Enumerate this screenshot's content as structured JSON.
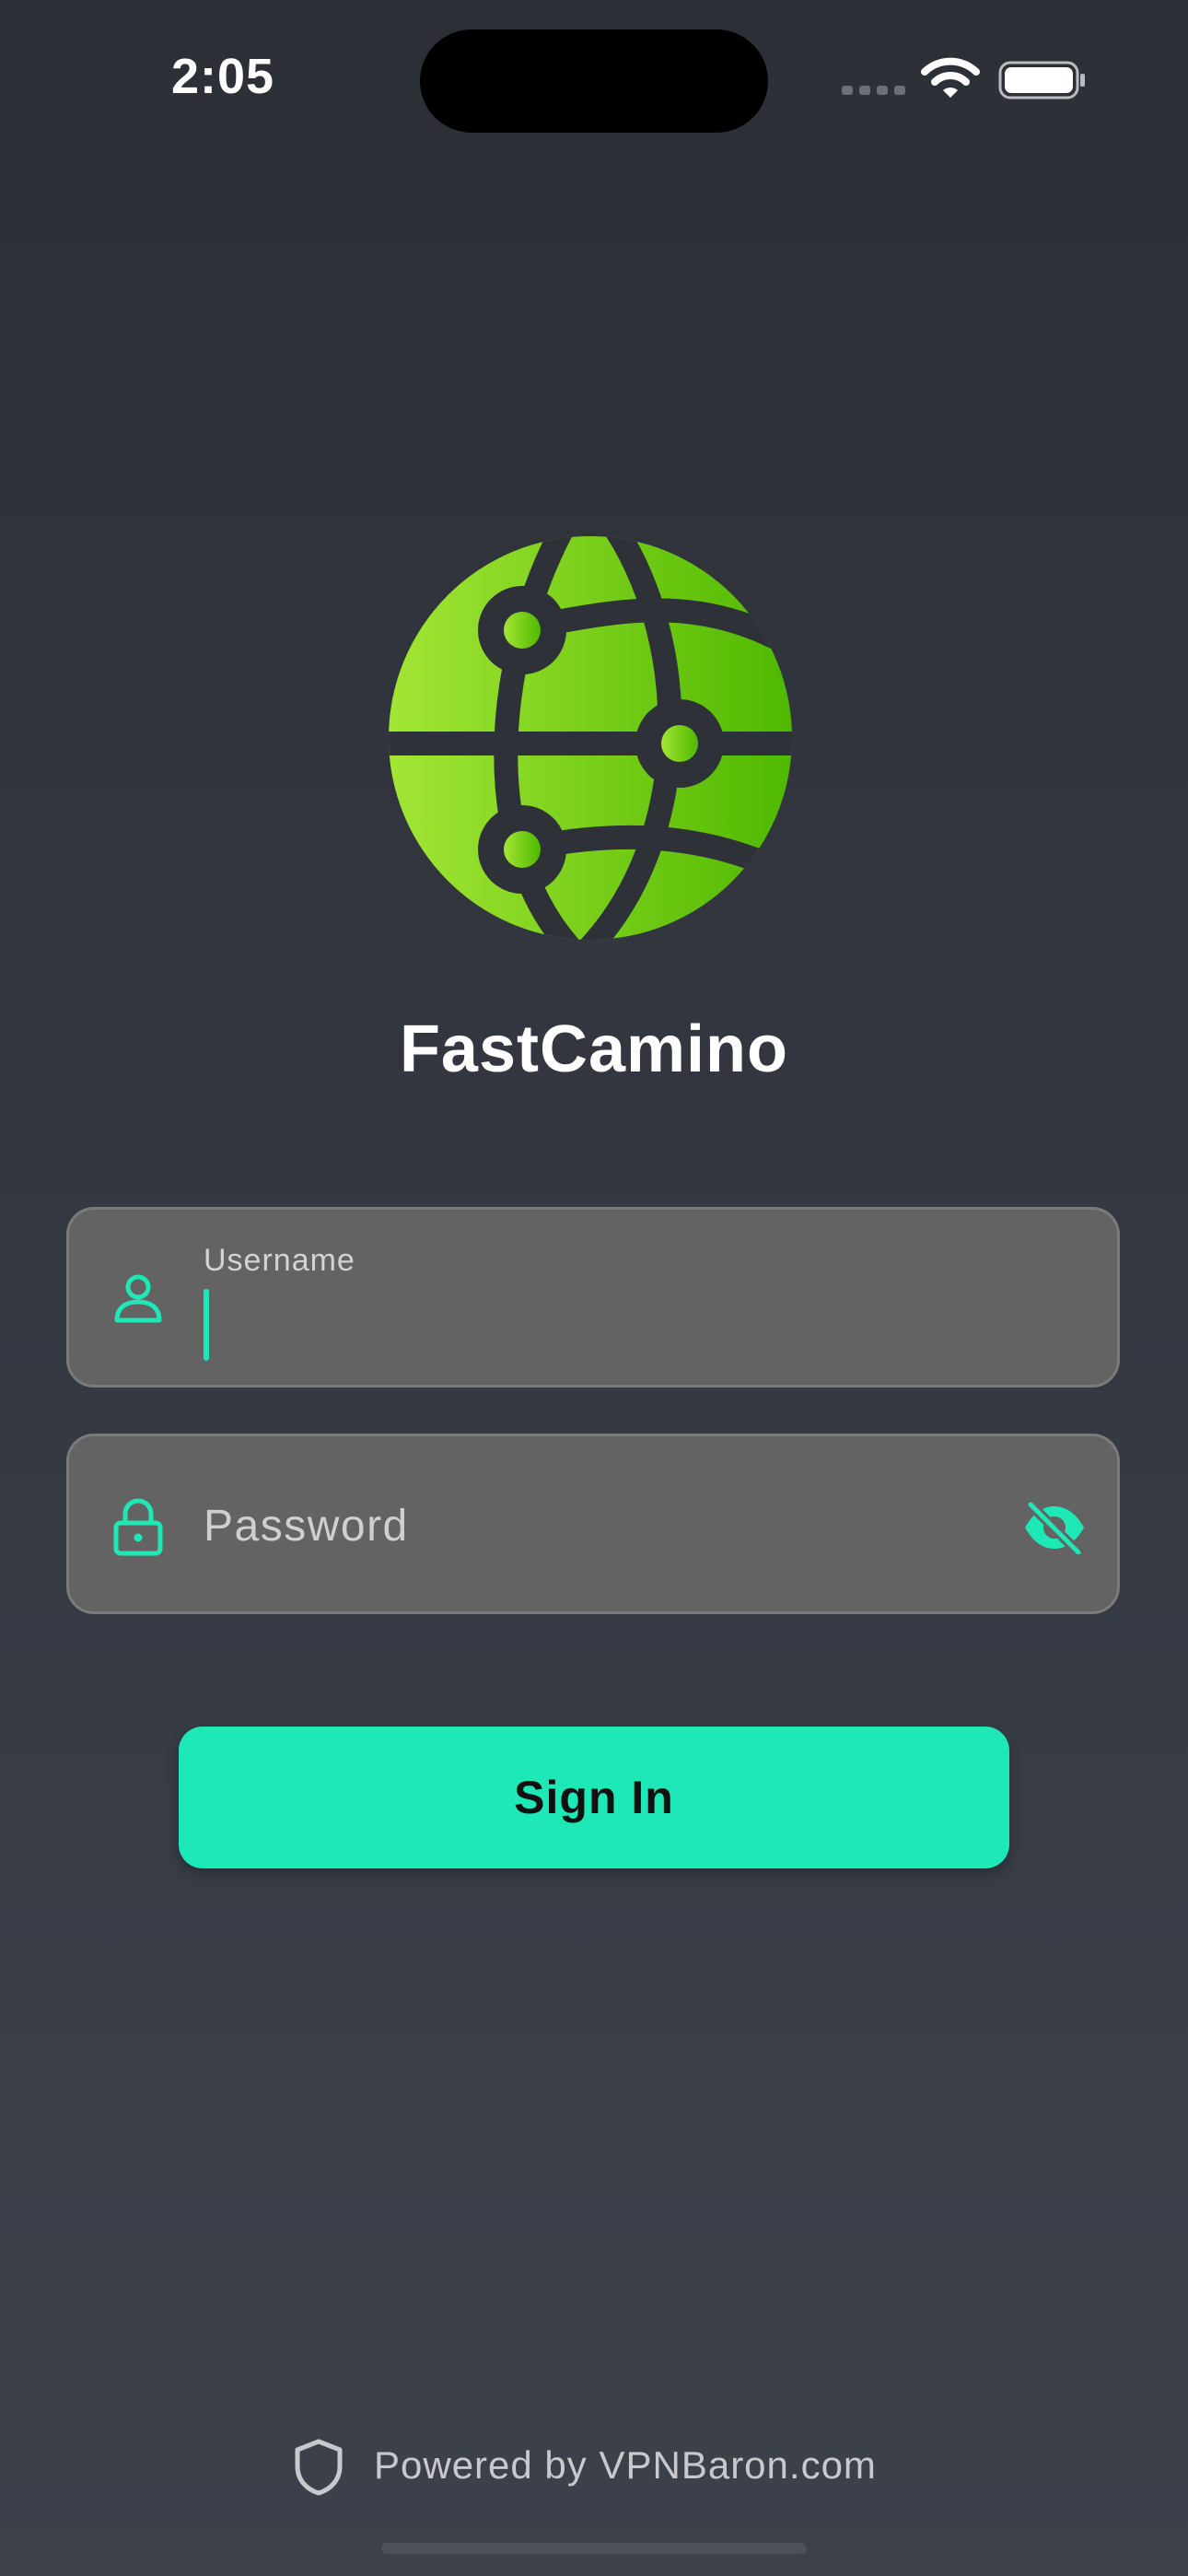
{
  "status_bar": {
    "time": "2:05"
  },
  "app": {
    "name": "FastCamino",
    "logo_icon": "globe-routes-logo-icon",
    "logo_colors": [
      "#a3e635",
      "#4fb800"
    ]
  },
  "form": {
    "username": {
      "label": "Username",
      "value": "",
      "icon": "person-icon"
    },
    "password": {
      "placeholder": "Password",
      "value": "",
      "icon": "lock-icon",
      "toggle_icon": "eye-off-icon"
    },
    "submit_label": "Sign In"
  },
  "footer": {
    "text": "Powered by VPNBaron.com",
    "icon": "shield-icon"
  },
  "colors": {
    "accent": "#1ee8b5",
    "background_top": "#2c2f36",
    "background_bottom": "#3d414a",
    "field_bg": "#636363"
  }
}
